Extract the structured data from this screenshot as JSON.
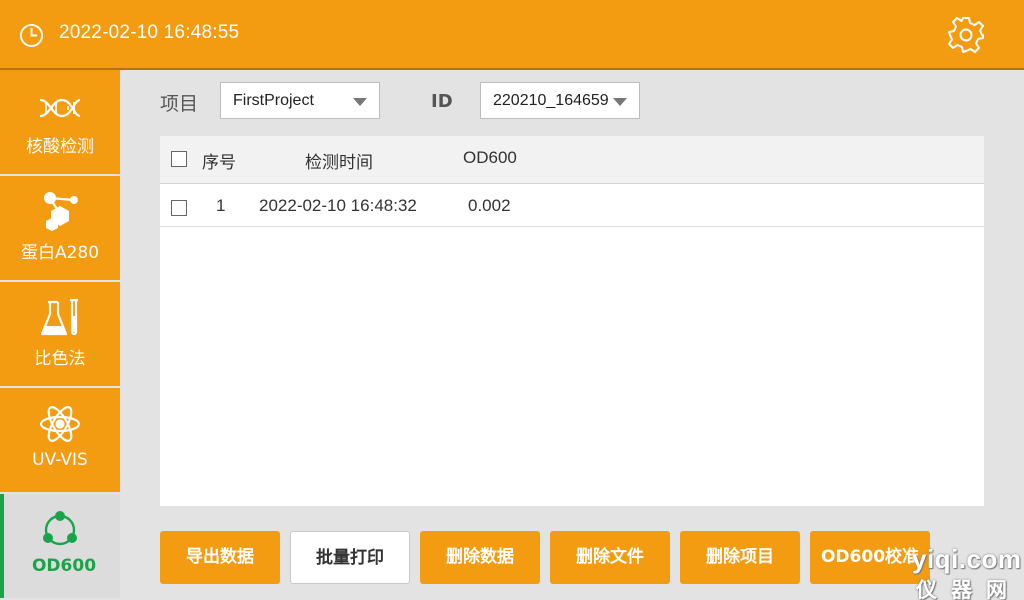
{
  "header": {
    "datetime": "2022-02-10 16:48:55"
  },
  "sidebar": {
    "items": [
      {
        "label": "核酸检测",
        "icon": "dna-icon"
      },
      {
        "label": "蛋白A280",
        "icon": "molecule-icon"
      },
      {
        "label": "比色法",
        "icon": "flask-icon"
      },
      {
        "label": "UV-VIS",
        "icon": "atom-icon"
      },
      {
        "label": "OD600",
        "icon": "cells-icon",
        "active": true
      }
    ]
  },
  "filters": {
    "project_label": "项目",
    "project_value": "FirstProject",
    "id_label": "ID",
    "id_value": "220210_164659"
  },
  "table": {
    "columns": [
      "序号",
      "检测时间",
      "OD600"
    ],
    "rows": [
      {
        "index": "1",
        "time": "2022-02-10 16:48:32",
        "od600": "0.002"
      }
    ]
  },
  "actions": {
    "export": "导出数据",
    "batch_print": "批量打印",
    "delete_data": "删除数据",
    "delete_file": "删除文件",
    "delete_project": "删除项目",
    "od600_calibrate": "OD600校准"
  },
  "watermark": {
    "line1": "yiqi.com",
    "line2": "仪器网"
  },
  "colors": {
    "accent": "#f39c12",
    "active_green": "#1aa34a"
  }
}
